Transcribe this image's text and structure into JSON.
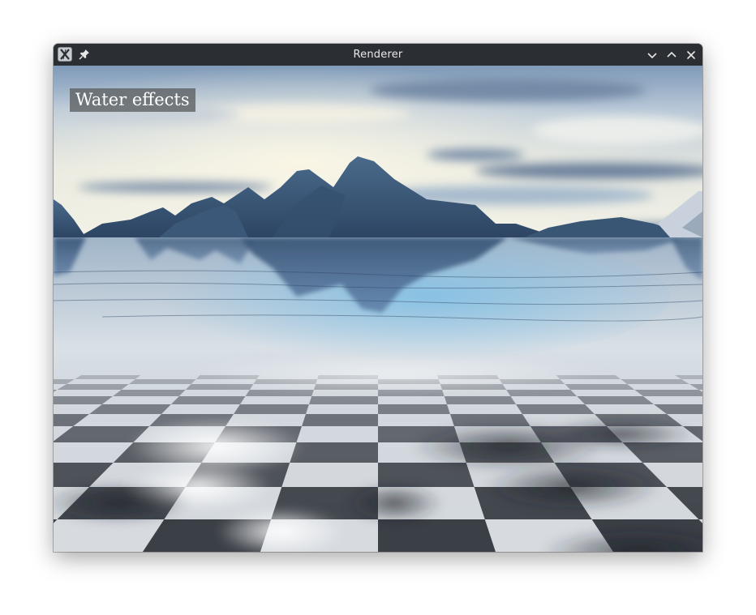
{
  "window": {
    "title": "Renderer",
    "controls": [
      "minimize",
      "maximize",
      "close"
    ]
  },
  "titlebar": {
    "app_icon": "x-app-icon",
    "pin_icon": "pin-icon",
    "background": "#2b2e33"
  },
  "scene": {
    "overlay_label": "Water effects",
    "elements": [
      "sky",
      "clouds",
      "mountains",
      "water-reflection",
      "checkered-floor"
    ],
    "colors": {
      "sky_top": "#8fa9c4",
      "horizon": "#f1f0e4",
      "mountain": "#43607f",
      "floor_light": "#d7dbe0",
      "floor_dark": "#3b3f46"
    }
  }
}
